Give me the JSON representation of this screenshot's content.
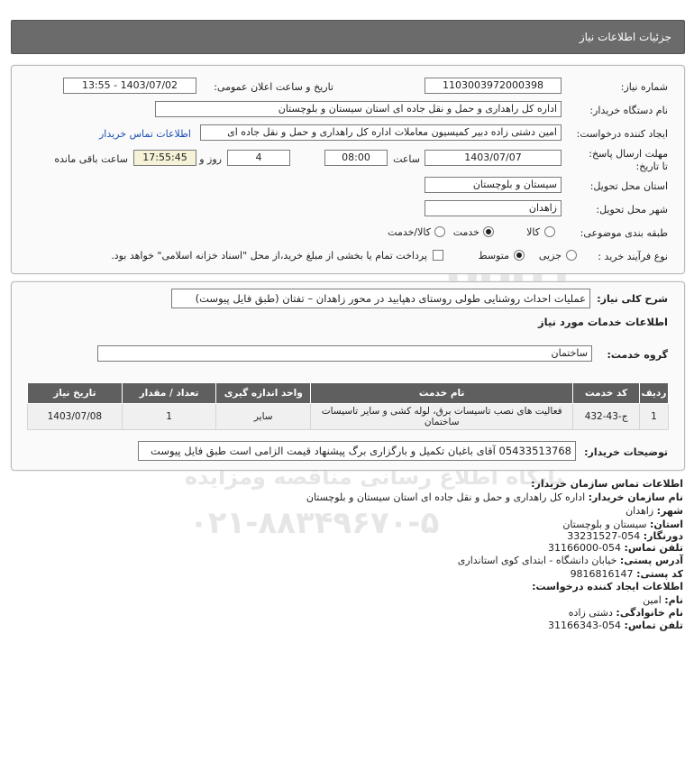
{
  "header": {
    "title": "جزئیات اطلاعات نیاز"
  },
  "form": {
    "need_number_label": "شماره نیاز:",
    "need_number": "1103003972000398",
    "announce_label": "تاریخ و ساعت اعلان عمومی:",
    "announce_value": "1403/07/02 - 13:55",
    "buyer_label": "نام دستگاه خریدار:",
    "buyer_value": "اداره کل راهداری و حمل و نقل جاده ای استان سیستان و بلوچستان",
    "creator_label": "ایجاد کننده درخواست:",
    "creator_value": "امین دشتی زاده دبیر کمیسیون معاملات اداره کل راهداری و حمل و نقل جاده ای",
    "contact_link": "اطلاعات تماس خریدار",
    "deadline_label": "مهلت ارسال پاسخ: تا تاریخ:",
    "deadline_date": "1403/07/07",
    "time_label": "ساعت",
    "deadline_time": "08:00",
    "days_count": "4",
    "days_label": "روز و",
    "remaining_time": "17:55:45",
    "remaining_label": "ساعت باقی مانده",
    "province_label": "استان محل تحویل:",
    "province_value": "سیستان و بلوچستان",
    "city_label": "شهر محل تحویل:",
    "city_value": "زاهدان",
    "category_label": "طبقه بندی موضوعی:",
    "category_options": [
      "کالا",
      "خدمت",
      "کالا/خدمت"
    ],
    "category_selected": "خدمت",
    "process_label": "نوع فرآیند خرید :",
    "process_options": [
      "جزیی",
      "متوسط"
    ],
    "process_selected": "متوسط",
    "treasury_note": "پرداخت تمام یا بخشی از مبلغ خرید،از محل \"اسناد خزانه اسلامی\" خواهد بود."
  },
  "details": {
    "summary_label": "شرح کلی نیاز:",
    "summary_value": "عملیات احداث روشنایی طولی روستای دهپابید در محور زاهدان – تفتان (طبق فایل پیوست)",
    "services_title": "اطلاعات خدمات مورد نیاز",
    "service_group_label": "گروه خدمت:",
    "service_group_value": "ساختمان",
    "table_headers": [
      "ردیف",
      "کد خدمت",
      "نام خدمت",
      "واحد اندازه گیری",
      "تعداد / مقدار",
      "تاریخ نیاز"
    ],
    "table_rows": [
      [
        "1",
        "ج-43-432",
        "فعالیت های نصب تاسیسات برق، لوله کشی و سایر تاسیسات ساختمان",
        "سایر",
        "1",
        "1403/07/08"
      ]
    ],
    "notes_label": "توضیحات خریدار:",
    "notes_value": "05433513768 آقای باغبان تکمیل و بارگزاری برگ پیشنهاد قیمت الزامی است طبق فایل پیوست"
  },
  "contact": {
    "title": "اطلاعات تماس سازمان خریدار:",
    "org_label": "نام سازمان خریدار:",
    "org_value": "اداره کل راهداری و حمل و نقل جاده ای استان سیستان و بلوچستان",
    "city_label": "شهر:",
    "city_value": "زاهدان",
    "province_label": "استان:",
    "province_value": "سیستان و بلوچستان",
    "fax_label": "دورنگار:",
    "fax_value": "054-33231527",
    "phone_label": "تلفن تماس:",
    "phone_value": "054-31166000",
    "address_label": "آدرس پستی:",
    "address_value": "خیابان دانشگاه - ابتدای کوی استانداری",
    "postal_label": "کد پستی:",
    "postal_value": "9816816147",
    "creator_title": "اطلاعات ایجاد کننده درخواست:",
    "name_label": "نام:",
    "name_value": "امین",
    "family_label": "نام خانوادگی:",
    "family_value": "دشتی زاده",
    "creator_phone_label": "تلفن تماس:",
    "creator_phone_value": "054-31166343"
  },
  "watermark": {
    "brand": "ParsNamadData",
    "slogan": "پایگاه اطلاع رسانی مناقصه ومزایده",
    "phone": "۰۲۱-۸۸۳۴۹۶۷۰-۵",
    "digits": "0101 0001"
  }
}
